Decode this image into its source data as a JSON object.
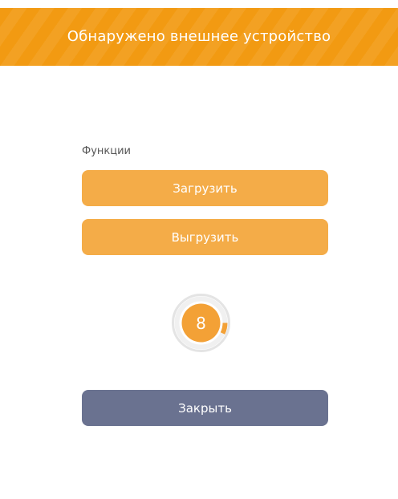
{
  "dialog": {
    "title": "Обнаружено внешнее устройство"
  },
  "functions": {
    "label": "Функции",
    "upload_label": "Загрузить",
    "download_label": "Выгрузить"
  },
  "countdown": {
    "value": "8"
  },
  "footer": {
    "close_label": "Закрыть"
  },
  "colors": {
    "header": "#f29a12",
    "button_orange": "#f4ac48",
    "button_close": "#6a7290",
    "countdown_fill": "#f3a136"
  }
}
